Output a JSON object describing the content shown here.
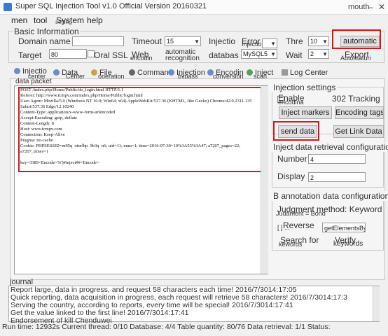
{
  "window": {
    "title": "Super SQL Injection Tool v1.0 Official Version 20160321",
    "corner_text": "mouth",
    "minimize": "–",
    "close": "✕"
  },
  "menu": [
    "men",
    "tool",
    "System",
    "help"
  ],
  "menu_overlay": "setting",
  "basic": {
    "heading": "Basic Information",
    "domain_label": "Domain name or IP",
    "timeout_label": "Timeout",
    "timeout_value": "15",
    "injection_label": "Injectio",
    "error_label": "Error",
    "injection_sub": "Injection",
    "thread_label": "Thre",
    "thread_value": "10",
    "automatic_button": "automatic",
    "target_label": "Target",
    "target_value": "80",
    "oral_ssl_label": "Oral SSL",
    "web_label": "Web",
    "web_sub": "encodin",
    "automatic_recognition": "automatic recognition",
    "database_label": "databas",
    "database_value": "MySQL5",
    "wait_label": "Wait",
    "wait_value": "2",
    "export_label": "Export",
    "export_sub": "Automaturi"
  },
  "tabs": {
    "row1": [
      "Injectio",
      "Data",
      "File",
      "Comman",
      "Injection",
      "Encodin",
      "Inject",
      "Log Center"
    ],
    "row2": [
      "center",
      "Center",
      "operation",
      "bypass",
      "conversion",
      "scan"
    ]
  },
  "packet": {
    "label": "data packet",
    "text": "POST /index.php/Home/Public/do_login.html HTTP/1.1\nReferer: http://www.tcmpv.com/index.php/Home/Public/login.html\nUser-Agent: Mozilla/5.0 (Windows NT 10.0; Win64; x64) AppleWebKit/537.36 (KHTML, like Gecko) Chrome/42.0.2311.135 Safari/537.36 Edge/12.10240\nContent-Type: application/x-www-form-urlencoded\nAccept-Encoding: gzip, deflate\nContent-Length: 8\nHost: www.tcmpv.com\nConnection: Keep-Alive\nPragma: no-cache\nCookie: PHPSESSID=m95q  oturlhp  9b3q  n6; uid=11; num=1; time=2016-07-30+10%3A55%3A47; a7207_pages=22; a7207_times=1\n\nkey=3389<Encode>%')#inject##<Encode>"
  },
  "injection_settings": {
    "heading": "Injection settings",
    "enable_label": "Enable",
    "enable_sub": "encodina",
    "tracking_label": "302 Tracking",
    "inject_markers": "Inject markers",
    "encoding_tags": "Encoding tags",
    "send_data": "send data",
    "get_link_data": "Get Link Data"
  },
  "retrieval": {
    "heading": "Inject data retrieval configuration",
    "number_label": "Number",
    "number_value": "4",
    "display_label": "Display",
    "display_value": "2"
  },
  "annotation": {
    "heading": "B annotation data configuration",
    "judgment_label": "Judgment method: Keyword",
    "judgment_sub": "Judament = Bond",
    "reverse_label": "Reverse",
    "reverse_sub": "[ ] ...",
    "reverse_value": "getElementsByT",
    "search_label": "Search for",
    "search_sub": "kewords",
    "verify_label": "Verify",
    "verify_sub": "keywords"
  },
  "journal": {
    "label": "journal",
    "lines": [
      "Report large, data in progress, and request 58 characters each time! 2016/7/3014:17:05",
      "Quick reporting, data acquisition in progress, each request will retrieve 58 characters! 2016/7/3014:17:3",
      "Serving the country, according to reports, every time will be special! 2016/7/3014:17:41",
      "Get the value linked to the first line! 2016/7/3014:17:41",
      "Endorsement of kill Chenduwei"
    ]
  },
  "status_bar": "Run time: 12932s Current thread: 0/10 Database: 4/4 Table quantity: 80/76 Data retrieval: 1/1 Status:",
  "colors": {
    "highlight": "#d0191b",
    "background": "#f0f0f0"
  }
}
